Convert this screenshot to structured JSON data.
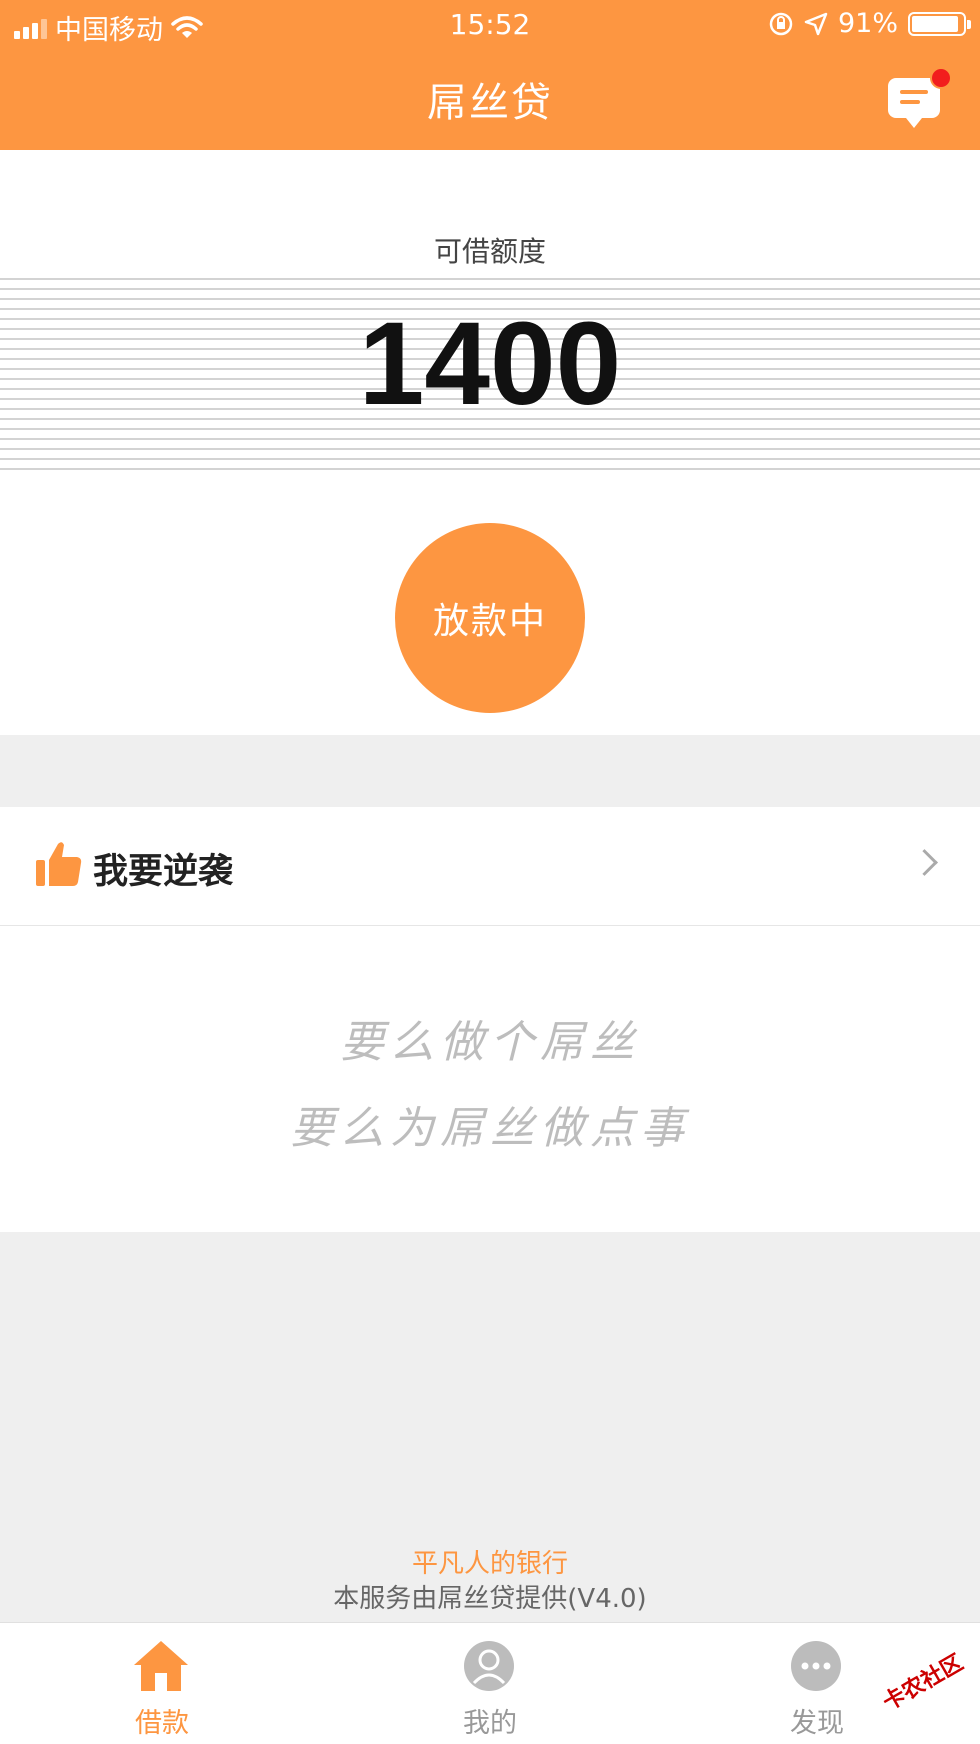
{
  "status_bar": {
    "carrier": "中国移动",
    "time": "15:52",
    "battery": "91%",
    "battery_level": 0.91
  },
  "nav": {
    "title": "屌丝贷"
  },
  "credit": {
    "label": "可借额度",
    "amount": "1400",
    "status_button": "放款中"
  },
  "counterattack": {
    "label": "我要逆袭"
  },
  "slogan": {
    "line1": "要么做个屌丝",
    "line2": "要么为屌丝做点事"
  },
  "footer": {
    "tagline": "平凡人的银行",
    "provider": "本服务由屌丝贷提供(V4.0)"
  },
  "tabs": [
    {
      "label": "借款",
      "icon": "home-icon",
      "active": true
    },
    {
      "label": "我的",
      "icon": "user-icon",
      "active": false
    },
    {
      "label": "发现",
      "icon": "more-icon",
      "active": false
    }
  ],
  "watermark": "卡农社区",
  "colors": {
    "accent": "#fd9641",
    "background": "#efefef",
    "notification_dot": "#f21d1d"
  }
}
